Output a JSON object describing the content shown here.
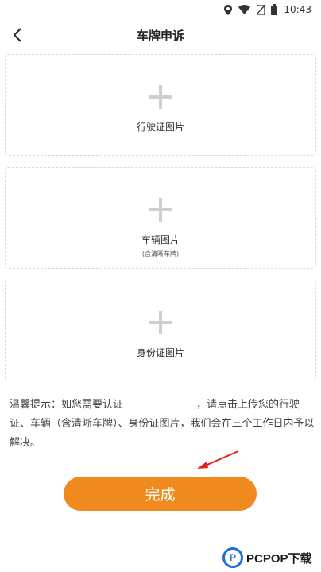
{
  "status_bar": {
    "time": "10:43",
    "icons": [
      "location-icon",
      "wifi-icon",
      "no-sim-icon",
      "battery-icon"
    ]
  },
  "nav": {
    "title": "车牌申诉",
    "back_icon": "chevron-left-icon"
  },
  "cards": [
    {
      "label": "行驶证图片",
      "icon": "plus-icon"
    },
    {
      "label": "车辆图片",
      "sublabel": "(含清晰车牌)",
      "icon": "plus-icon"
    },
    {
      "label": "身份证图片",
      "icon": "plus-icon"
    }
  ],
  "tip": {
    "part1": "温馨提示：如您需要认证",
    "part2": "，请点击上传您的行驶证、车辆（含清晰车牌）、身份证图片，我们会在三个工作日内予以解决。"
  },
  "done_button": {
    "label": "完成"
  },
  "colors": {
    "accent": "#f08a1f",
    "annotation_arrow": "#e02020",
    "watermark_blue": "#1e6fd9"
  },
  "watermark": {
    "logo_letter": "P",
    "text": "PCPOP下载"
  }
}
